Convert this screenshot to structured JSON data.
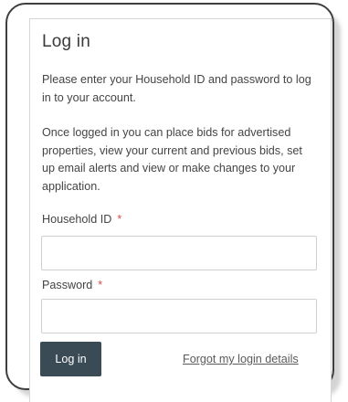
{
  "form": {
    "title": "Log in",
    "intro": "Please enter your Household ID and password to log in to your account.",
    "description": "Once logged in you can place bids for advertised properties, view your current and previous bids, set up email alerts and view or make changes to your application.",
    "household_id_label": "Household ID",
    "household_id_value": "",
    "password_label": "Password",
    "password_value": "",
    "required_marker": "*",
    "login_button_label": "Log in",
    "forgot_link_label": "Forgot my login details"
  },
  "colors": {
    "button_bg": "#3b4b55",
    "required": "#d94a4a",
    "card_border": "#3e3e3e"
  }
}
